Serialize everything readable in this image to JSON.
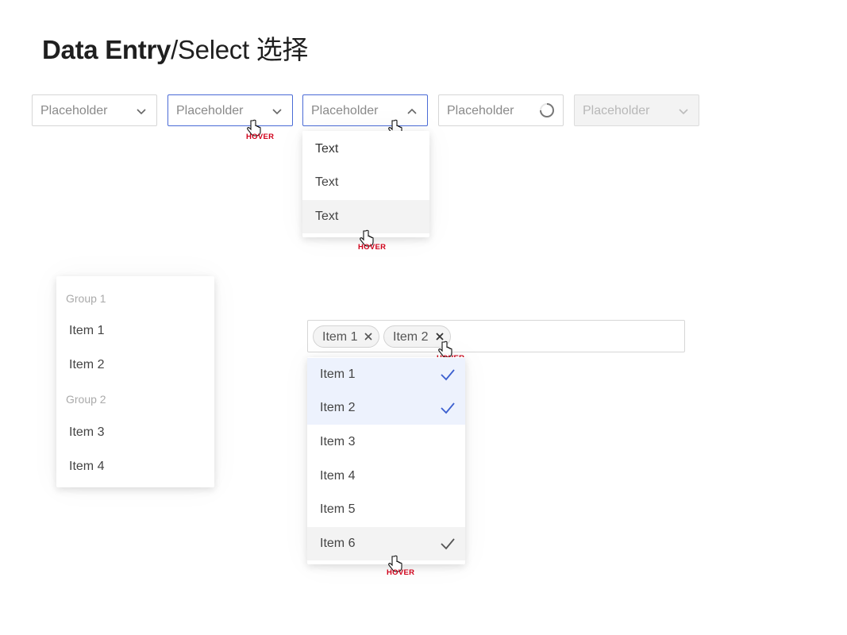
{
  "title": {
    "bold": "Data Entry",
    "light": "/Select 选择"
  },
  "selects": [
    {
      "placeholder": "Placeholder",
      "state": "default"
    },
    {
      "placeholder": "Placeholder",
      "state": "hover"
    },
    {
      "placeholder": "Placeholder",
      "state": "open"
    },
    {
      "placeholder": "Placeholder",
      "state": "loading"
    },
    {
      "placeholder": "Placeholder",
      "state": "disabled"
    }
  ],
  "hover_label": "HOVER",
  "dropdown": {
    "items": [
      "Text",
      "Text",
      "Text"
    ]
  },
  "grouped_menu": {
    "groups": [
      {
        "label": "Group 1",
        "items": [
          "Item 1",
          "Item 2"
        ]
      },
      {
        "label": "Group 2",
        "items": [
          "Item 3",
          "Item 4"
        ]
      }
    ]
  },
  "multi_select": {
    "tags": [
      "Item 1",
      "Item 2"
    ],
    "options": [
      {
        "label": "Item 1",
        "selected": true
      },
      {
        "label": "Item 2",
        "selected": true
      },
      {
        "label": "Item 3",
        "selected": false
      },
      {
        "label": "Item 4",
        "selected": false
      },
      {
        "label": "Item 5",
        "selected": false
      },
      {
        "label": "Item 6",
        "selected": true
      }
    ]
  },
  "colors": {
    "accent": "#4a6bd6",
    "hover_tag": "#d0021b",
    "selected_bg": "#edf2fd",
    "hover_bg": "#f3f3f3"
  }
}
